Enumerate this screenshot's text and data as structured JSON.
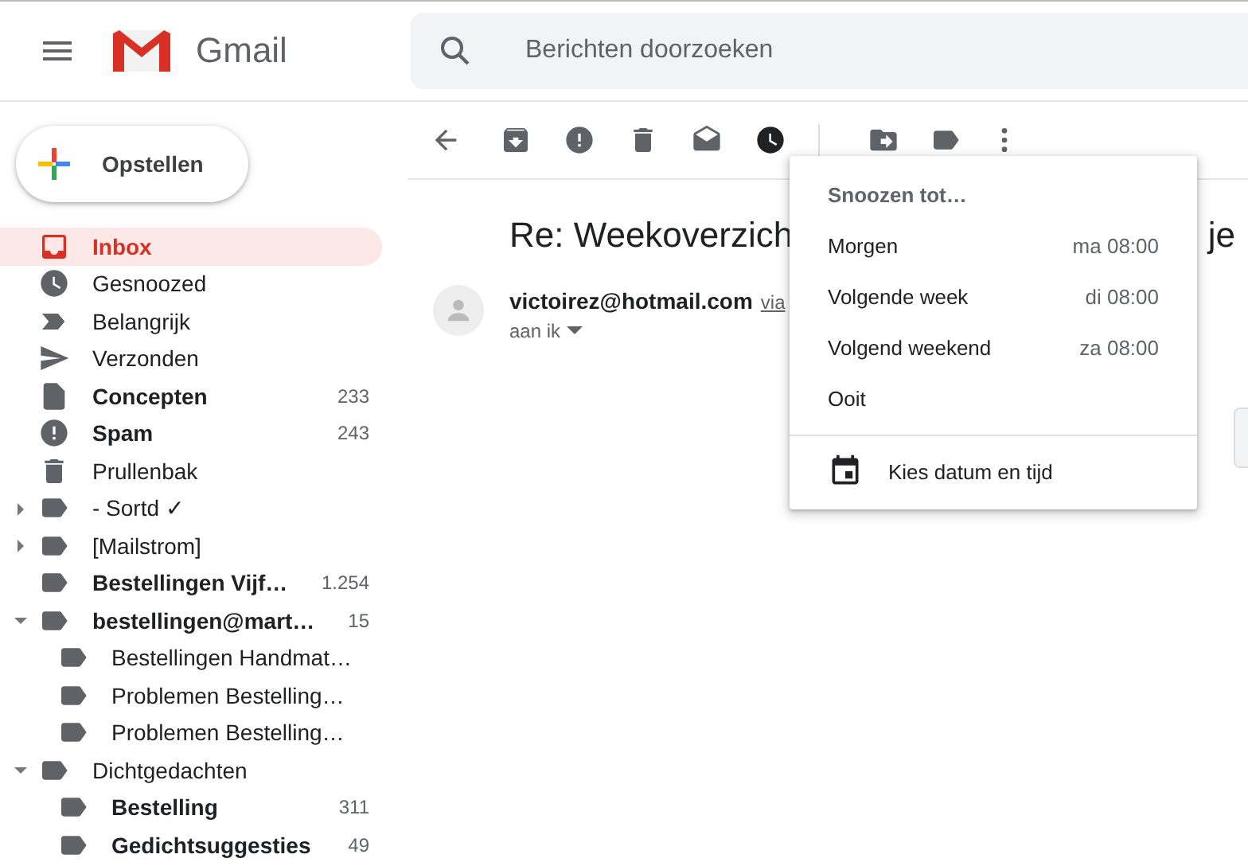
{
  "header": {
    "app_name": "Gmail",
    "search": {
      "placeholder": "Berichten doorzoeken"
    }
  },
  "compose": {
    "label": "Opstellen"
  },
  "sidebar": {
    "items": [
      {
        "label": "Inbox",
        "kind": "inbox",
        "selected": true,
        "unread": true
      },
      {
        "label": "Gesnoozed",
        "kind": "snoozed",
        "selected": false,
        "unread": false
      },
      {
        "label": "Belangrijk",
        "kind": "important",
        "selected": false,
        "unread": false
      },
      {
        "label": "Verzonden",
        "kind": "sent",
        "selected": false,
        "unread": false
      },
      {
        "label": "Concepten",
        "kind": "drafts",
        "selected": false,
        "unread": true,
        "count": "233"
      },
      {
        "label": "Spam",
        "kind": "spam",
        "selected": false,
        "unread": true,
        "count": "243"
      },
      {
        "label": "Prullenbak",
        "kind": "trash",
        "selected": false,
        "unread": false
      },
      {
        "label": "- Sortd ✓",
        "kind": "label",
        "selected": false,
        "unread": false,
        "expanded": false
      },
      {
        "label": "[Mailstrom]",
        "kind": "label",
        "selected": false,
        "unread": false,
        "expanded": false
      },
      {
        "label": "Bestellingen Vijf…",
        "kind": "label",
        "selected": false,
        "unread": true,
        "count": "1.254"
      },
      {
        "label": "bestellingen@mart…",
        "kind": "label",
        "selected": false,
        "unread": true,
        "count": "15",
        "expanded": true,
        "children": [
          {
            "label": "Bestellingen Handmat…",
            "kind": "label",
            "selected": false,
            "unread": false
          },
          {
            "label": "Problemen Bestelling…",
            "kind": "label",
            "selected": false,
            "unread": false
          },
          {
            "label": "Problemen Bestelling…",
            "kind": "label",
            "selected": false,
            "unread": false
          }
        ]
      },
      {
        "label": "Dichtgedachten",
        "kind": "label",
        "selected": false,
        "unread": false,
        "expanded": true,
        "children": [
          {
            "label": "Bestelling",
            "kind": "label",
            "selected": false,
            "unread": true,
            "count": "311"
          },
          {
            "label": "Gedichtsuggesties",
            "kind": "label",
            "selected": false,
            "unread": true,
            "count": "49"
          }
        ]
      }
    ]
  },
  "message": {
    "subject_start": "Re: Weekoverzich",
    "subject_end": "je",
    "sender": "victoirez@hotmail.com",
    "via": "via",
    "recipient": "aan ik"
  },
  "snooze_menu": {
    "title": "Snoozen tot…",
    "options": [
      {
        "label": "Morgen",
        "time": "ma 08:00"
      },
      {
        "label": "Volgende week",
        "time": "di 08:00"
      },
      {
        "label": "Volgend weekend",
        "time": "za 08:00"
      },
      {
        "label": "Ooit"
      }
    ],
    "custom": {
      "label": "Kies datum en tijd"
    }
  }
}
